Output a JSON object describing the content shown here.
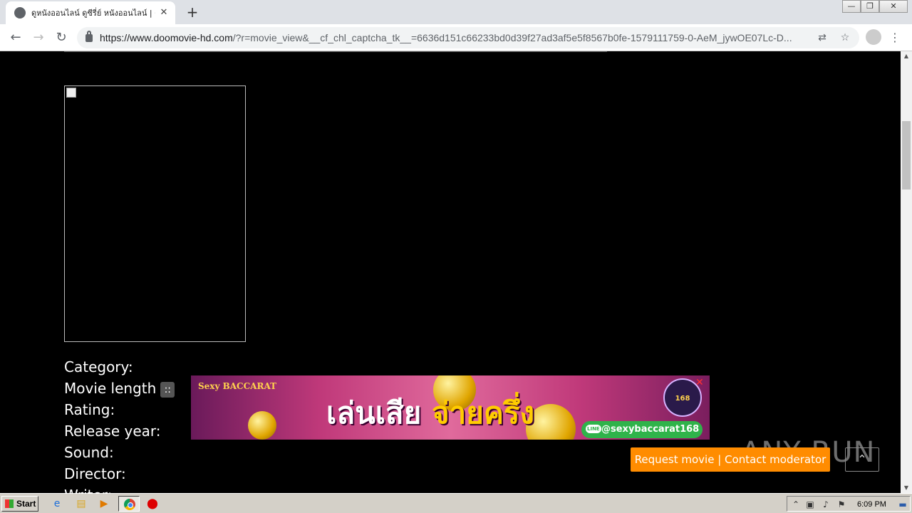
{
  "browser": {
    "tab_title": "ดูหนังออนไลน์ ดูซีรี่ย์ หนังออนไลน์ | ดู",
    "new_tab_label": "+",
    "url_host": "https://www.doomovie-hd.com",
    "url_rest": "/?r=movie_view&__cf_chl_captcha_tk__=6636d151c66233bd0d39f27ad3af5e5f8567b0fe-1579111759-0-AeM_jywOE07Lc-D...",
    "window_controls": [
      "—",
      "❐",
      "✕"
    ]
  },
  "movie": {
    "fields": [
      {
        "label": "Category:"
      },
      {
        "label": "Movie length"
      },
      {
        "label": "Rating:"
      },
      {
        "label": "Release year:"
      },
      {
        "label": "Sound:"
      },
      {
        "label": "Director:"
      },
      {
        "label": "Writer:"
      }
    ],
    "length_toggle": "::"
  },
  "ad": {
    "brand": "Sexy BACCARAT",
    "headline_white": "เล่นเสีย",
    "headline_gold": "จ่ายครึ่ง",
    "line_handle": "@sexybaccarat168",
    "badge": "168",
    "close": "✕"
  },
  "actions": {
    "request_movie": "Request movie | Contact moderator",
    "back_to_top": "⌃"
  },
  "watermark": "ANY RUN",
  "taskbar": {
    "start_label": "Start",
    "clock": "6:09 PM"
  },
  "colors": {
    "page_bg": "#000000",
    "request_button": "#ff8c00",
    "tab_bar": "#dee1e6"
  }
}
